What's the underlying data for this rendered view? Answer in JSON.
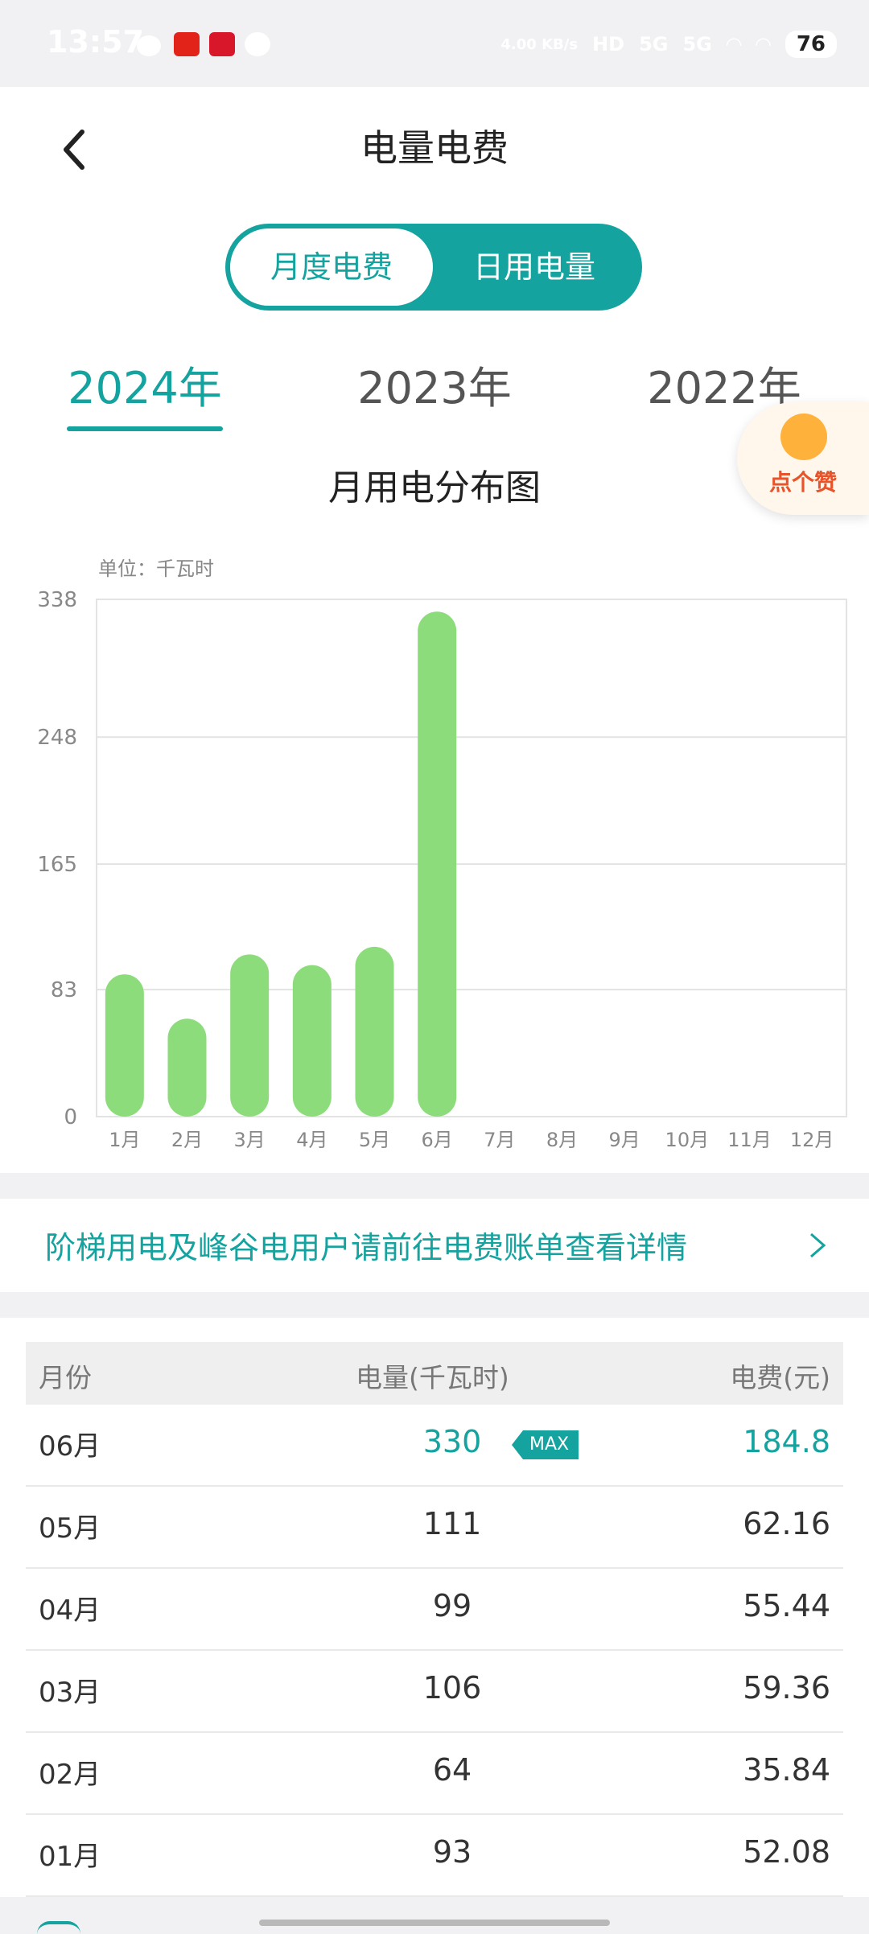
{
  "status_bar": {
    "time": "13:57",
    "net_speed": "4.00 KB/s",
    "hd": "HD",
    "signal1": "5G",
    "signal2": "5G",
    "battery": "76"
  },
  "header": {
    "title": "电量电费"
  },
  "toggle": {
    "monthly": "月度电费",
    "daily": "日用电量"
  },
  "years": [
    "2024年",
    "2023年",
    "2022年"
  ],
  "thumbs_up": {
    "label": "点个赞"
  },
  "chart_data": {
    "type": "bar",
    "title": "月用电分布图",
    "unit_label": "单位：千瓦时",
    "categories": [
      "1月",
      "2月",
      "3月",
      "4月",
      "5月",
      "6月",
      "7月",
      "8月",
      "9月",
      "10月",
      "11月",
      "12月"
    ],
    "values": [
      93,
      64,
      106,
      99,
      111,
      330,
      null,
      null,
      null,
      null,
      null,
      null
    ],
    "y_ticks": [
      0,
      83,
      165,
      248,
      338
    ],
    "ylim": [
      0,
      338
    ],
    "grid": true,
    "bar_color": "#8ddc7b"
  },
  "banner": {
    "text": "阶梯用电及峰谷电用户请前往电费账单查看详情"
  },
  "table": {
    "headers": [
      "月份",
      "电量(千瓦时)",
      "电费(元)"
    ],
    "max_badge": "MAX",
    "rows": [
      {
        "month": "06月",
        "kwh": "330",
        "fee": "184.8"
      },
      {
        "month": "05月",
        "kwh": "111",
        "fee": "62.16"
      },
      {
        "month": "04月",
        "kwh": "99",
        "fee": "55.44"
      },
      {
        "month": "03月",
        "kwh": "106",
        "fee": "59.36"
      },
      {
        "month": "02月",
        "kwh": "64",
        "fee": "35.84"
      },
      {
        "month": "01月",
        "kwh": "93",
        "fee": "52.08"
      }
    ]
  },
  "colors": {
    "accent": "#14a39f",
    "bar": "#8ddc7b"
  }
}
